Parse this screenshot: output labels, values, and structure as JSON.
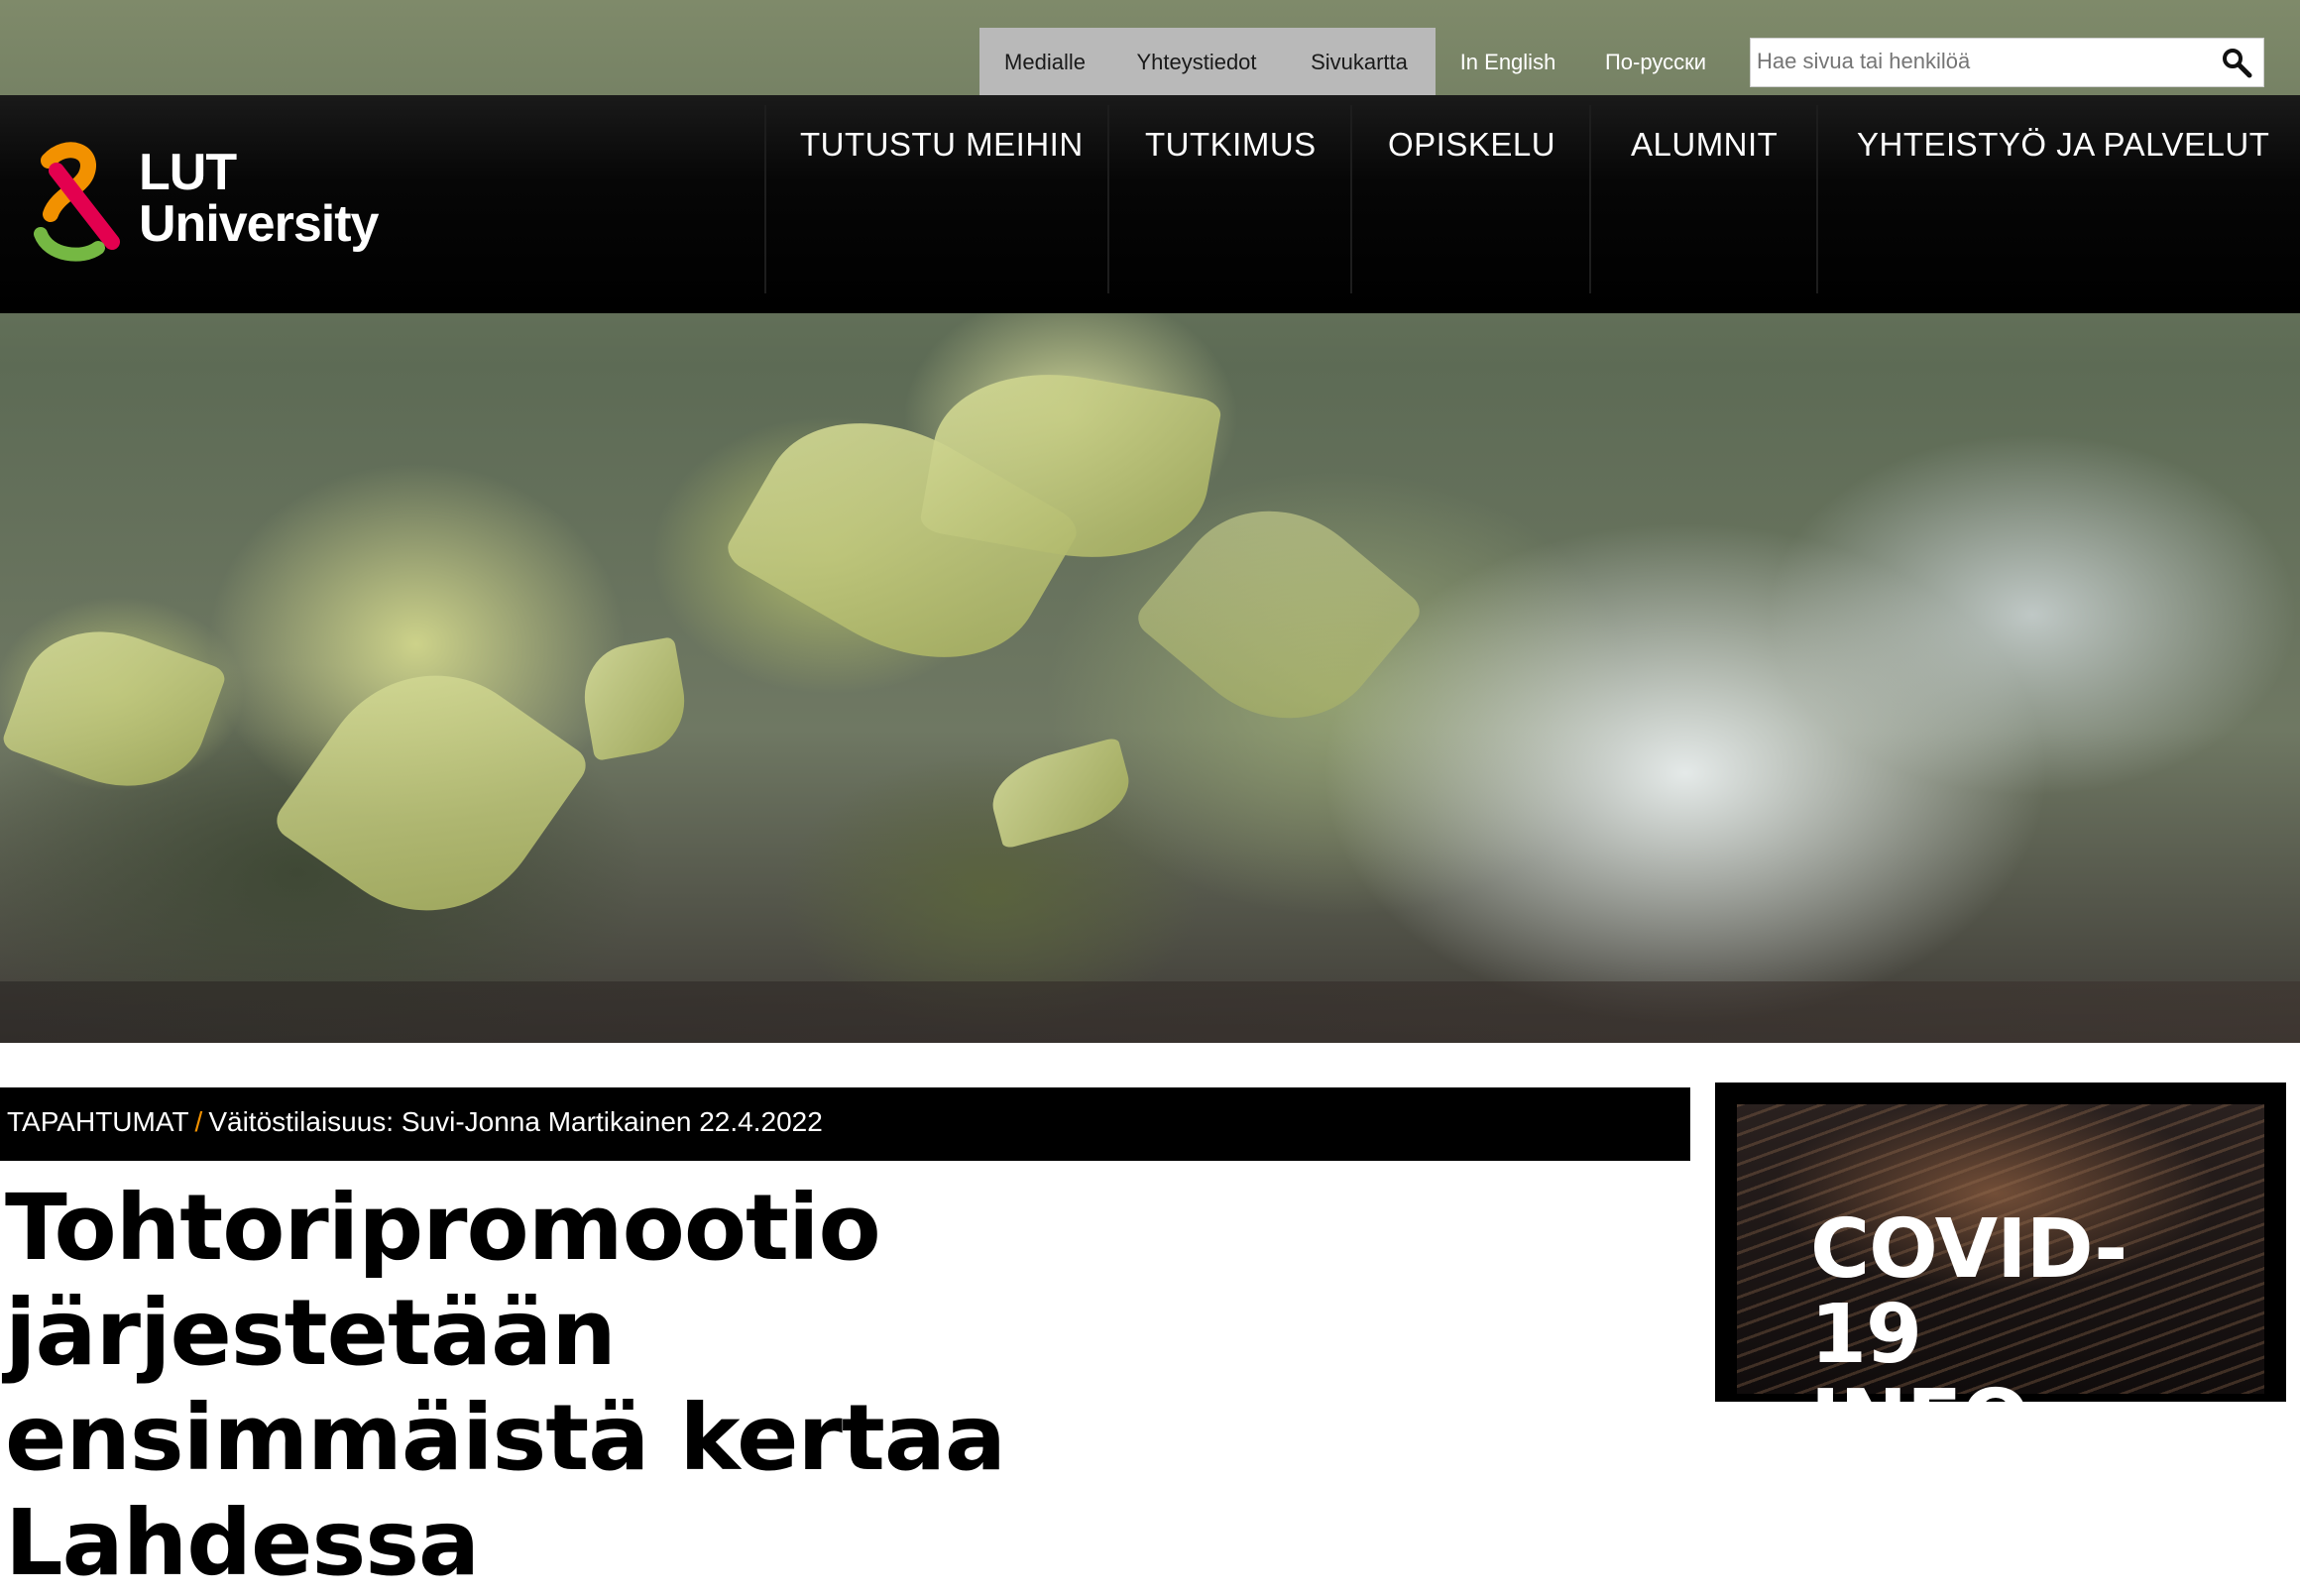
{
  "utility_links": {
    "medialle": "Medialle",
    "yhteystiedot": "Yhteystiedot",
    "sivukartta": "Sivukartta",
    "english": "In English",
    "russian": "По-русски"
  },
  "search": {
    "placeholder": "Hae sivua tai henkilöä"
  },
  "logo": {
    "line1": "LUT",
    "line2": "University"
  },
  "nav": {
    "items": [
      {
        "label": "TUTUSTU MEIHIN"
      },
      {
        "label": "TUTKIMUS"
      },
      {
        "label": "OPISKELU"
      },
      {
        "label": "ALUMNIT"
      },
      {
        "label": "YHTEISTYÖ JA PALVELUT"
      }
    ]
  },
  "breadcrumb": {
    "section": "TAPAHTUMAT",
    "separator": "/",
    "current": "Väitöstilaisuus: Suvi-Jonna Martikainen 22.4.2022"
  },
  "headline": {
    "line1": "Tohtoripromootio järjestetään",
    "line2": "ensimmäistä kertaa Lahdessa"
  },
  "covid_card": {
    "line1": "COVID-19",
    "line2": "INFO"
  },
  "colors": {
    "brand_orange": "#f29100",
    "brand_red": "#e3004f",
    "brand_green": "#75b843",
    "nav_background": "#000000"
  }
}
